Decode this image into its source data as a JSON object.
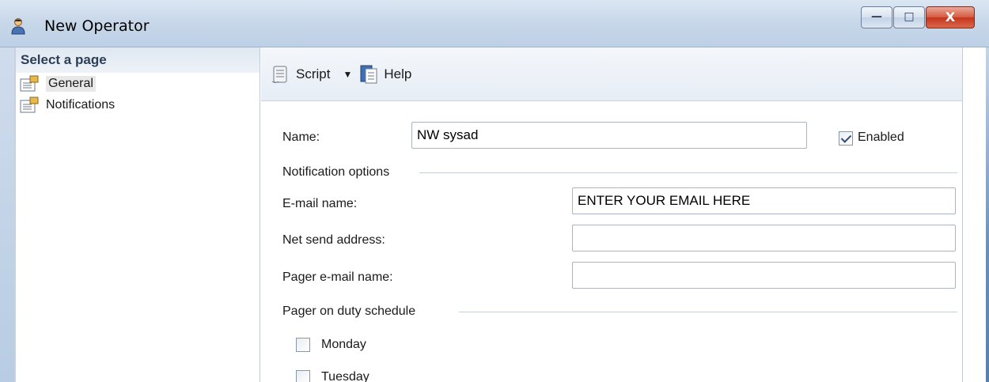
{
  "window": {
    "title": "New Operator",
    "buttons": {
      "minimize": "—",
      "maximize": "□",
      "close": "X"
    }
  },
  "left_pane": {
    "header": "Select a page",
    "items": [
      {
        "label": "General",
        "selected": true
      },
      {
        "label": "Notifications",
        "selected": false
      }
    ]
  },
  "toolbar": {
    "script_label": "Script",
    "help_label": "Help"
  },
  "form": {
    "name_label": "Name:",
    "name_value": "NW sysad",
    "enabled_label": "Enabled",
    "enabled_checked": true,
    "notification_group": "Notification options",
    "email_label": "E-mail name:",
    "email_value": "ENTER YOUR EMAIL HERE",
    "net_send_label": "Net send address:",
    "net_send_value": "",
    "pager_label": "Pager e-mail name:",
    "pager_value": "",
    "schedule_group": "Pager on duty schedule",
    "days": [
      {
        "label": "Monday",
        "checked": false
      },
      {
        "label": "Tuesday",
        "checked": false
      }
    ]
  }
}
